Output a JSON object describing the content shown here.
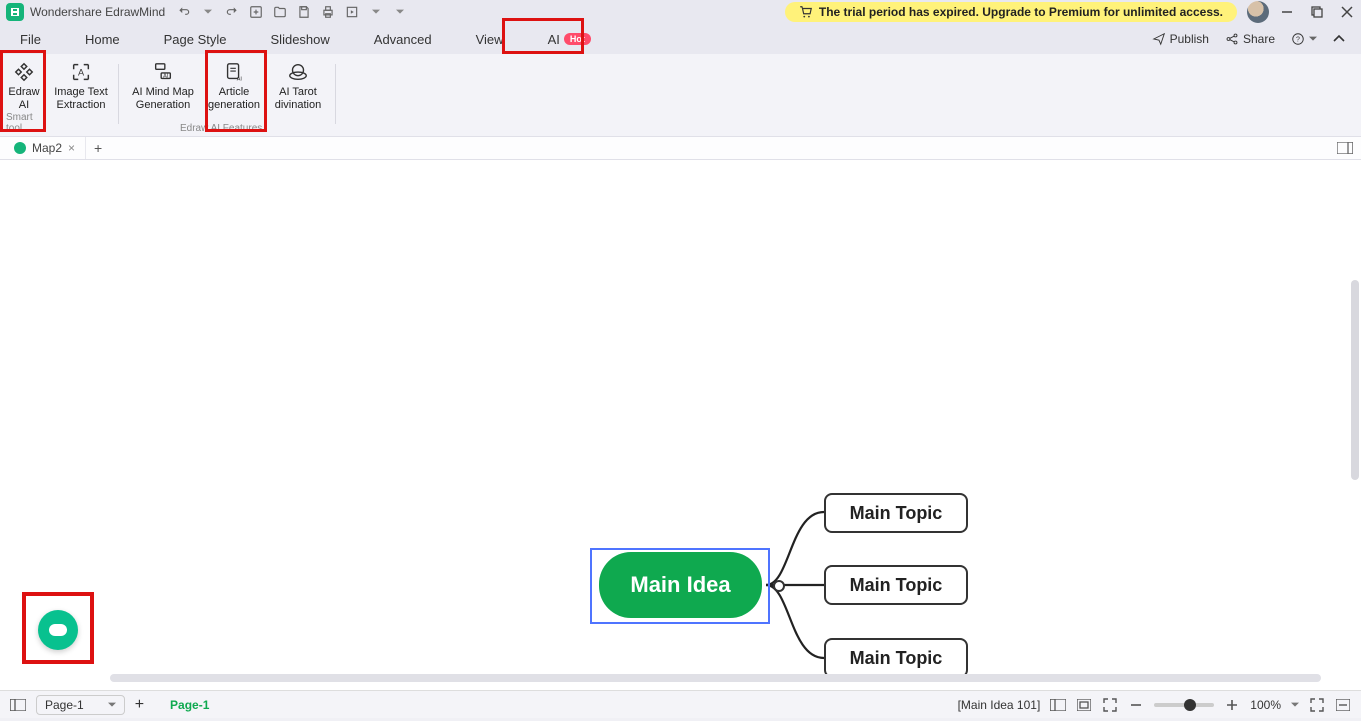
{
  "app": {
    "title": "Wondershare EdrawMind"
  },
  "trial_banner": "The trial period has expired. Upgrade to Premium for unlimited access.",
  "menubar": {
    "items": [
      "File",
      "Home",
      "Page Style",
      "Slideshow",
      "Advanced",
      "View",
      "AI"
    ],
    "ai_badge": "Hot",
    "publish": "Publish",
    "share": "Share"
  },
  "ribbon": {
    "group1_label": "Smart tool",
    "group2_label": "Edraw AI Features",
    "btns": [
      {
        "l1": "Edraw",
        "l2": "AI"
      },
      {
        "l1": "Image Text",
        "l2": "Extraction"
      },
      {
        "l1": "AI Mind Map",
        "l2": "Generation"
      },
      {
        "l1": "Article",
        "l2": "generation"
      },
      {
        "l1": "AI Tarot",
        "l2": "divination"
      }
    ]
  },
  "doc_tabs": {
    "tab1": "Map2"
  },
  "mindmap": {
    "root": "Main Idea",
    "topics": [
      "Main Topic",
      "Main Topic",
      "Main Topic"
    ]
  },
  "statusbar": {
    "page_dd": "Page-1",
    "page_tab": "Page-1",
    "selection": "[Main Idea 101]",
    "zoom": "100%"
  }
}
